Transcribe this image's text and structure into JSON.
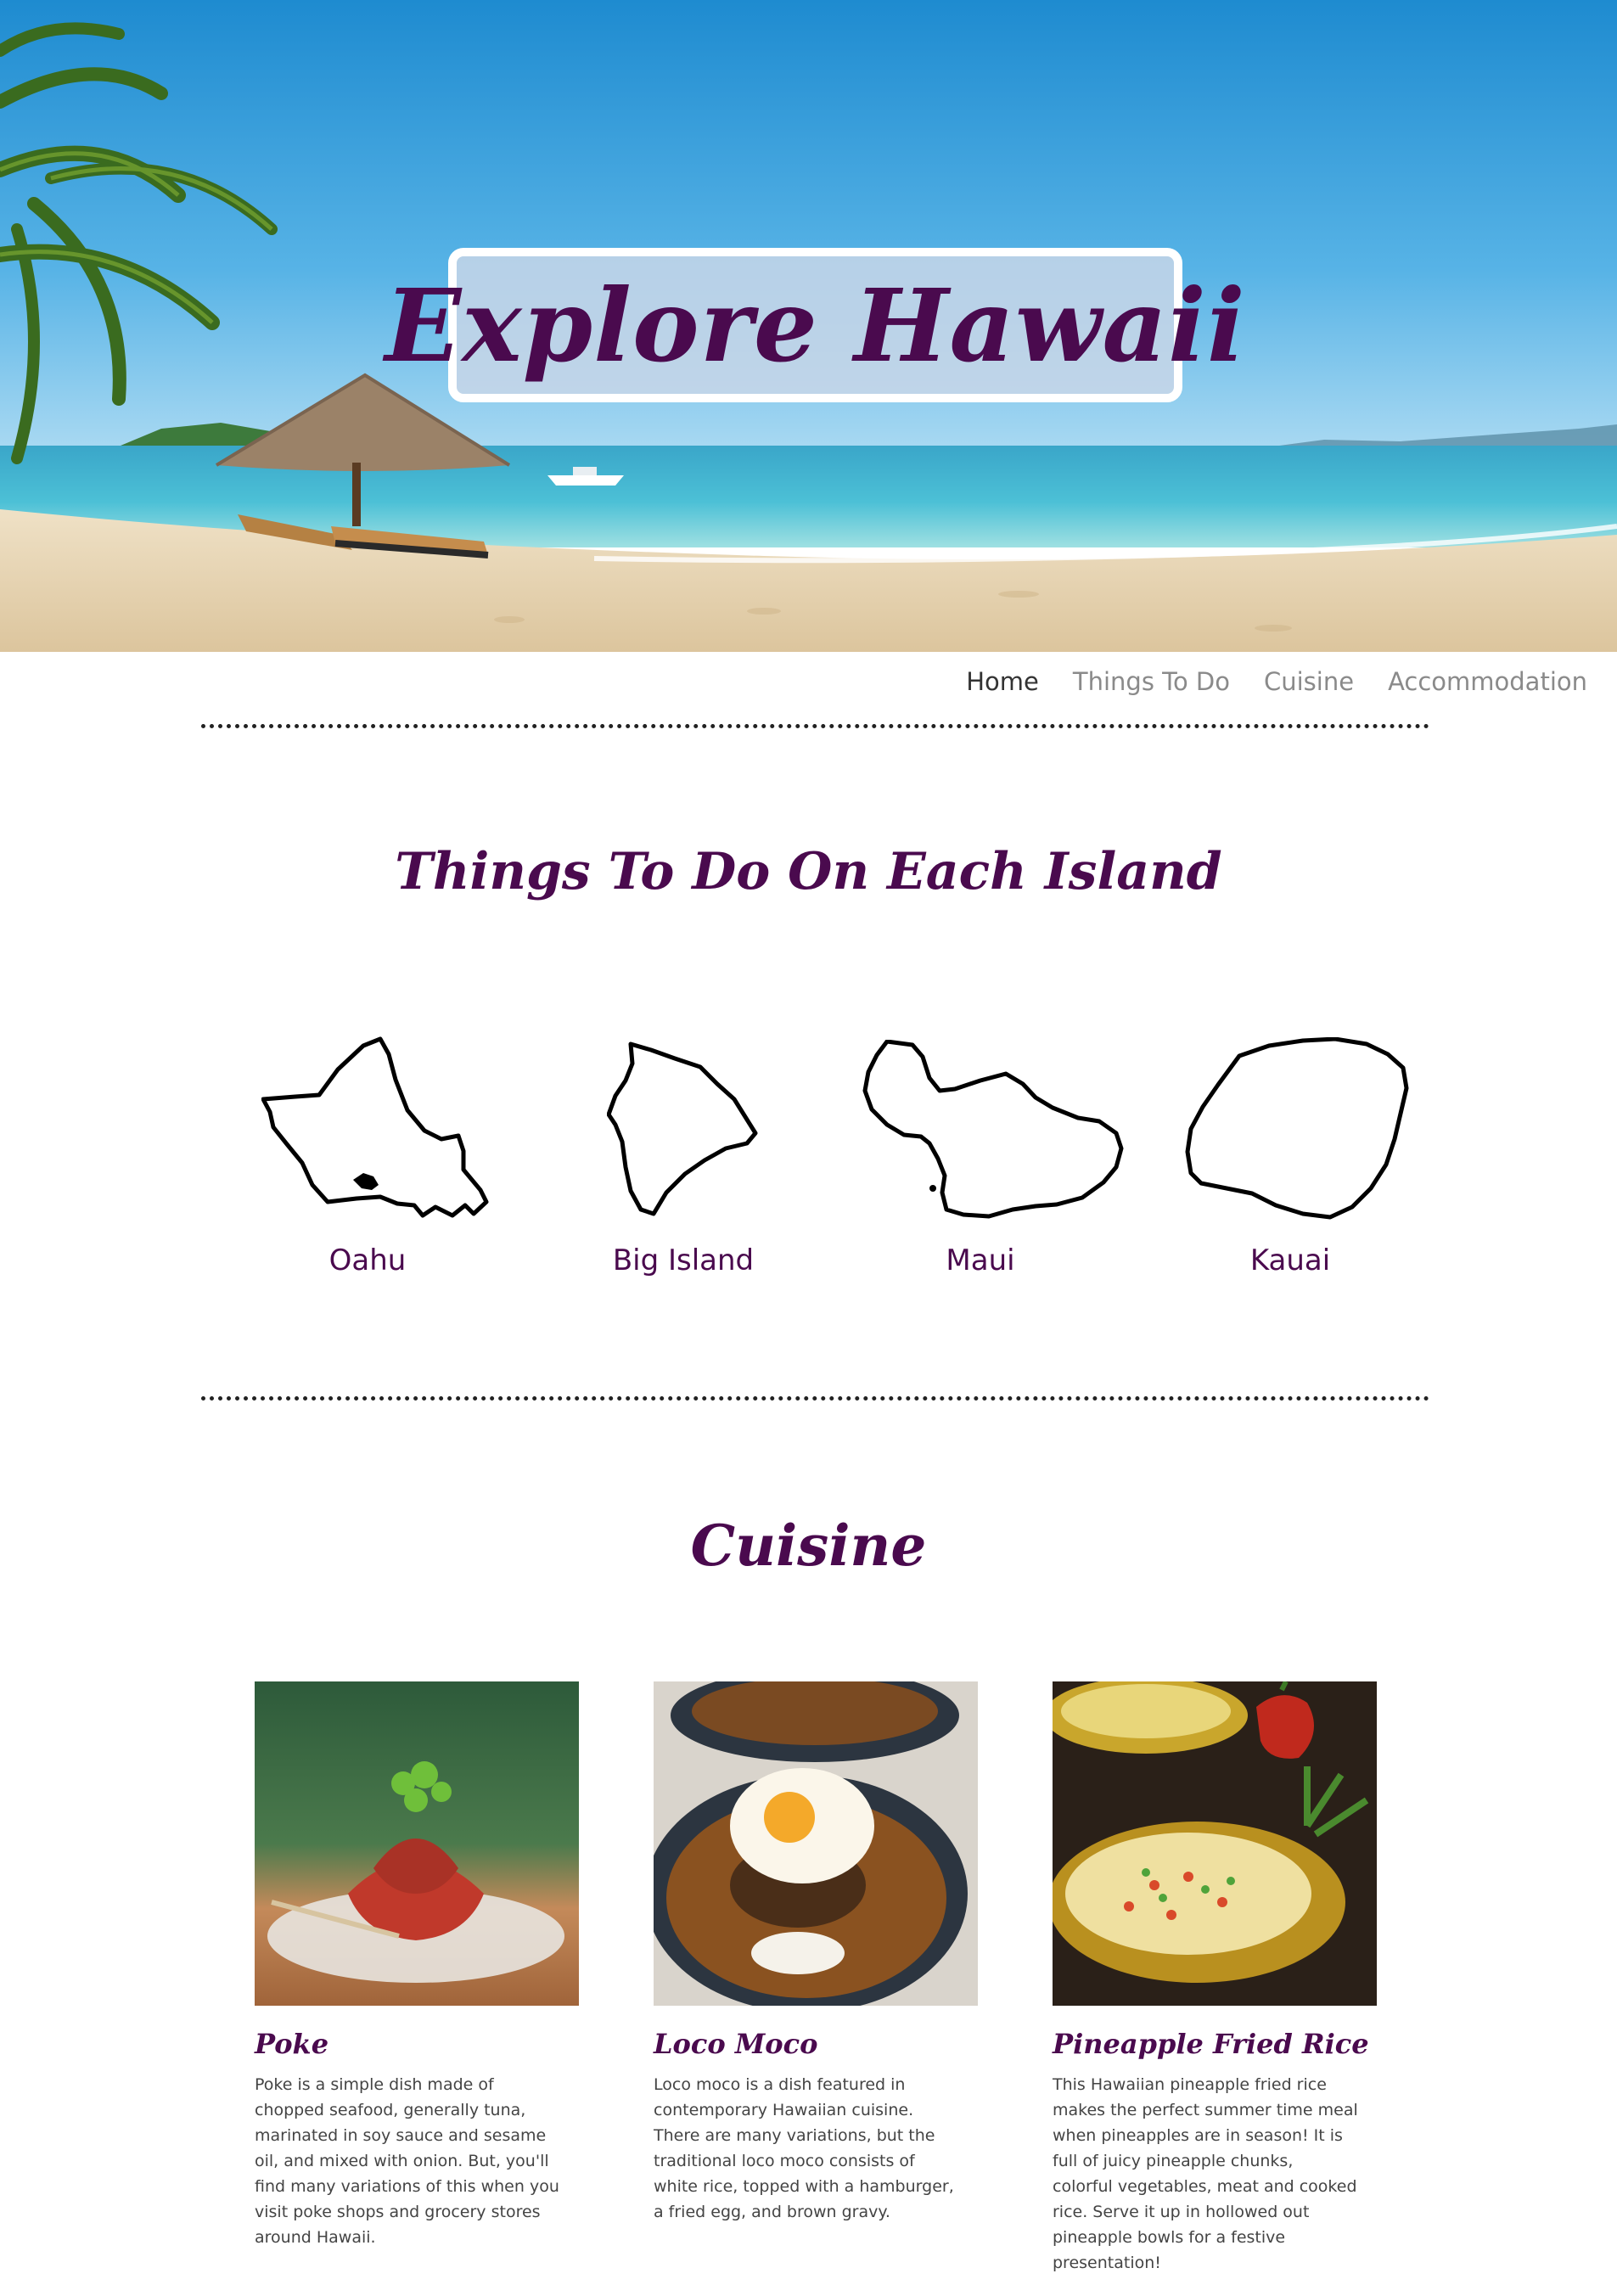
{
  "hero": {
    "title": "Explore Hawaii",
    "image": "tropical-beach-photo"
  },
  "nav": {
    "items": [
      {
        "label": "Home",
        "active": true
      },
      {
        "label": "Things To Do",
        "active": false
      },
      {
        "label": "Cuisine",
        "active": false
      },
      {
        "label": "Accommodation",
        "active": false
      }
    ]
  },
  "things_to_do": {
    "heading": "Things To Do On Each Island",
    "islands": [
      {
        "name": "Oahu",
        "icon": "oahu-outline-icon"
      },
      {
        "name": "Big Island",
        "icon": "big-island-outline-icon"
      },
      {
        "name": "Maui",
        "icon": "maui-outline-icon"
      },
      {
        "name": "Kauai",
        "icon": "kauai-outline-icon"
      }
    ]
  },
  "cuisine": {
    "heading": "Cuisine",
    "dishes": [
      {
        "name": "Poke",
        "image": "poke-photo",
        "description": "Poke is a simple dish made of chopped seafood, generally tuna, marinated in soy sauce and sesame oil, and mixed with onion. But, you'll find many variations of this when you visit poke shops and grocery stores around Hawaii."
      },
      {
        "name": "Loco Moco",
        "image": "loco-moco-photo",
        "description": "Loco moco is a dish featured in contemporary Hawaiian cuisine. There are many variations, but the traditional loco moco consists of white rice, topped with a hamburger, a fried egg, and brown gravy."
      },
      {
        "name": "Pineapple Fried Rice",
        "image": "pineapple-fried-rice-photo",
        "description": "This Hawaiian pineapple fried rice makes the perfect summer time meal when pineapples are in season! It is full of juicy pineapple chunks, colorful vegetables, meat and cooked rice. Serve it up in hollowed out pineapple bowls for a festive presentation!"
      }
    ]
  },
  "colors": {
    "accent": "#4a0a4e",
    "nav_active": "#333333",
    "nav_inactive": "#8a8a8a",
    "body_text": "#444444"
  }
}
